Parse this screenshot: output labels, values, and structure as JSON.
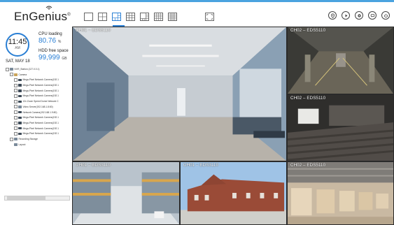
{
  "brand": {
    "logo_text": "EnGenius",
    "accent": "#2a7fd4"
  },
  "toolbar": {
    "layout_icons": [
      "layout-1x1-icon",
      "layout-2x2-icon",
      "layout-1plus5-icon",
      "layout-3x3-icon",
      "layout-1plus7-icon",
      "layout-4x4-icon",
      "layout-5x5-icon"
    ],
    "active_layout_index": 2,
    "fullscreen_icon": "fullscreen-icon",
    "right_icons": [
      "location-icon",
      "play-icon",
      "settings-icon",
      "chat-icon",
      "power-icon"
    ]
  },
  "status": {
    "time": "11:45",
    "ampm": "AM",
    "date": "SAT, MAY 18",
    "cpu_label": "CPU loading",
    "cpu_value": "80.76",
    "cpu_unit": "%",
    "hdd_label": "HDD free space",
    "hdd_value": "99,999",
    "hdd_unit": "GB"
  },
  "tree": {
    "root": "NVR_Station (127.0.0.1)",
    "camera_folder": "Camera",
    "cameras": [
      "Mega-Pixel Network Camera(192.1",
      "Mega-Pixel Network Camera(192.1",
      "Mega-Pixel Network Camera(192.1",
      "Mega-Pixel Network Camera(192.1",
      "12x Zoom Speed Dome Network C",
      "Video Server(192.168.1.8:80)",
      "Network Camera(192.168.1.9:80)",
      "Mega-Pixel Network Camera(192.1",
      "Mega-Pixel Network Camera(192.1",
      "Mega-Pixel Network Camera(192.1",
      "Mega-Pixel Network Camera(192.1"
    ],
    "recording_storage": "Recording Storage",
    "layout": "Layout"
  },
  "channels": [
    {
      "label": "CH01 – EDS3110"
    },
    {
      "label": "CH02 – EDS5110"
    },
    {
      "label": "CH02 – EDS5110"
    },
    {
      "label": "CH01 – EDS3110"
    },
    {
      "label": "CH01 – EDS3110"
    },
    {
      "label": "CH02 – EDS5110"
    }
  ]
}
